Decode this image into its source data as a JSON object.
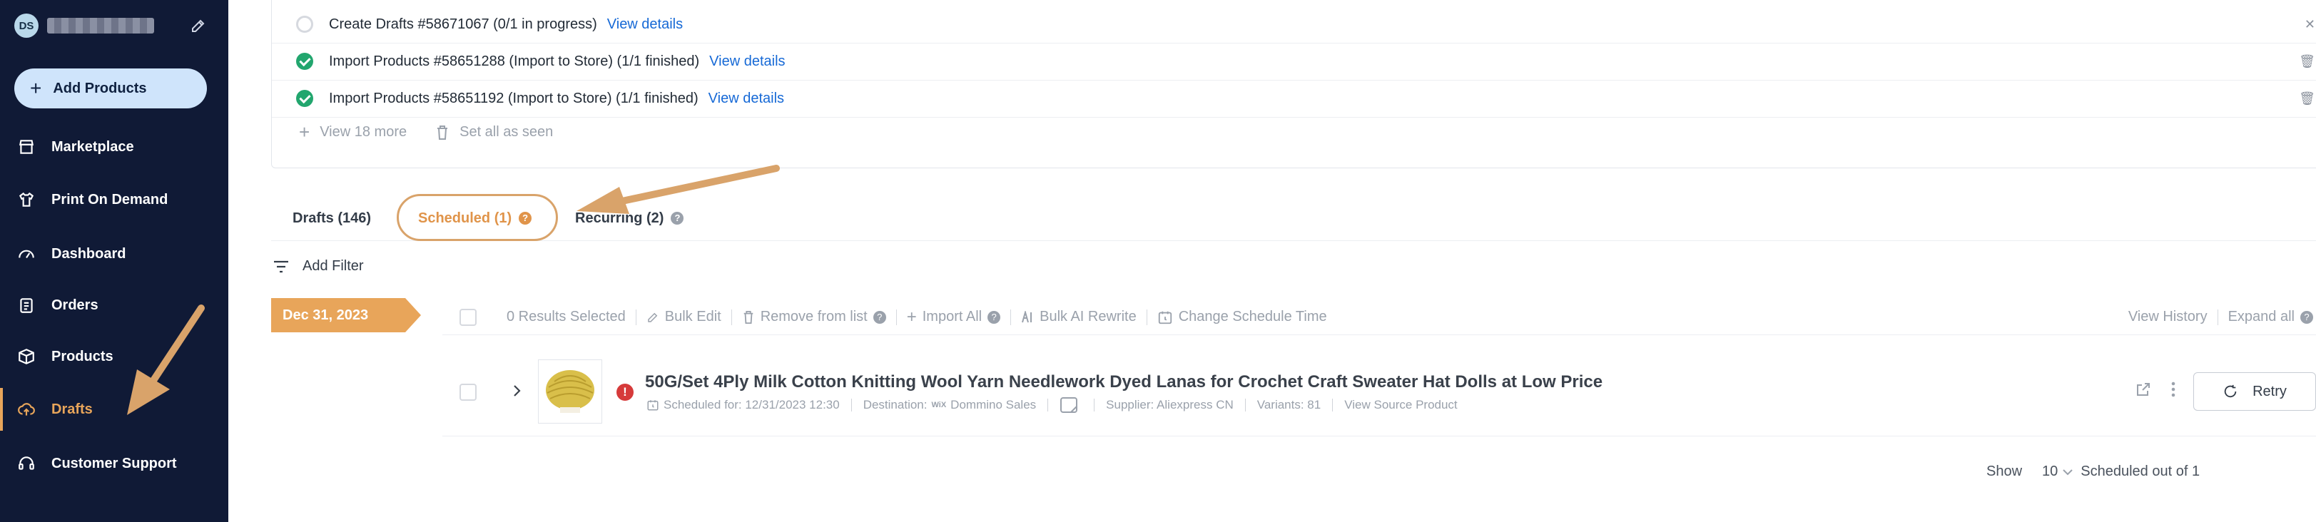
{
  "sidebar": {
    "avatar_initials": "DS",
    "user_name": "",
    "add_products": "Add Products",
    "items": [
      {
        "label": "Marketplace",
        "icon": "store-icon"
      },
      {
        "label": "Print On Demand",
        "icon": "print-on-demand-icon"
      },
      {
        "label": "Dashboard",
        "icon": "gauge-icon"
      },
      {
        "label": "Orders",
        "icon": "clipboard-icon"
      },
      {
        "label": "Products",
        "icon": "box-icon"
      },
      {
        "label": "Drafts",
        "icon": "cloud-upload-icon",
        "active": true
      },
      {
        "label": "Customer Support",
        "icon": "headset-icon"
      }
    ]
  },
  "notifications": {
    "rows": [
      {
        "text": "Create Drafts #58671067 (0/1 in progress)",
        "link": "View details",
        "status": "pending"
      },
      {
        "text": "Import Products #58651288 (Import to Store) (1/1 finished)",
        "link": "View details",
        "status": "done"
      },
      {
        "text": "Import Products #58651192 (Import to Store) (1/1 finished)",
        "link": "View details",
        "status": "done"
      }
    ],
    "view_more": "View 18 more",
    "set_all_seen": "Set all as seen"
  },
  "tabs": [
    {
      "label": "Drafts (146)",
      "active": false
    },
    {
      "label": "Scheduled (1)",
      "active": true
    },
    {
      "label": "Recurring (2)",
      "active": false
    }
  ],
  "filter": {
    "label": "Add Filter"
  },
  "date_tag": "Dec 31, 2023",
  "toolbar": {
    "selected": "0 Results Selected",
    "bulk_edit": "Bulk Edit",
    "remove": "Remove from list",
    "import_all": "Import All",
    "bulk_ai": "Bulk AI Rewrite",
    "change_time": "Change Schedule Time",
    "view_history": "View History",
    "expand_all": "Expand all"
  },
  "product": {
    "title": "50G/Set 4Ply Milk Cotton Knitting Wool Yarn Needlework Dyed Lanas for Crochet Craft Sweater Hat Dolls at Low Price",
    "scheduled": "Scheduled for: 12/31/2023 12:30",
    "destination_label": "Destination:",
    "destination_platform": "WiX",
    "destination_store": "Dommino Sales",
    "supplier": "Supplier: Aliexpress CN",
    "variants": "Variants: 81",
    "view_source": "View Source Product",
    "retry": "Retry"
  },
  "pager": {
    "show": "Show",
    "per_page": "10",
    "summary": "Scheduled out of 1"
  },
  "colors": {
    "sidebar_bg": "#101a36",
    "accent": "#e8a55a",
    "link": "#1669d6",
    "success": "#22a66e",
    "error": "#d63a3a"
  }
}
